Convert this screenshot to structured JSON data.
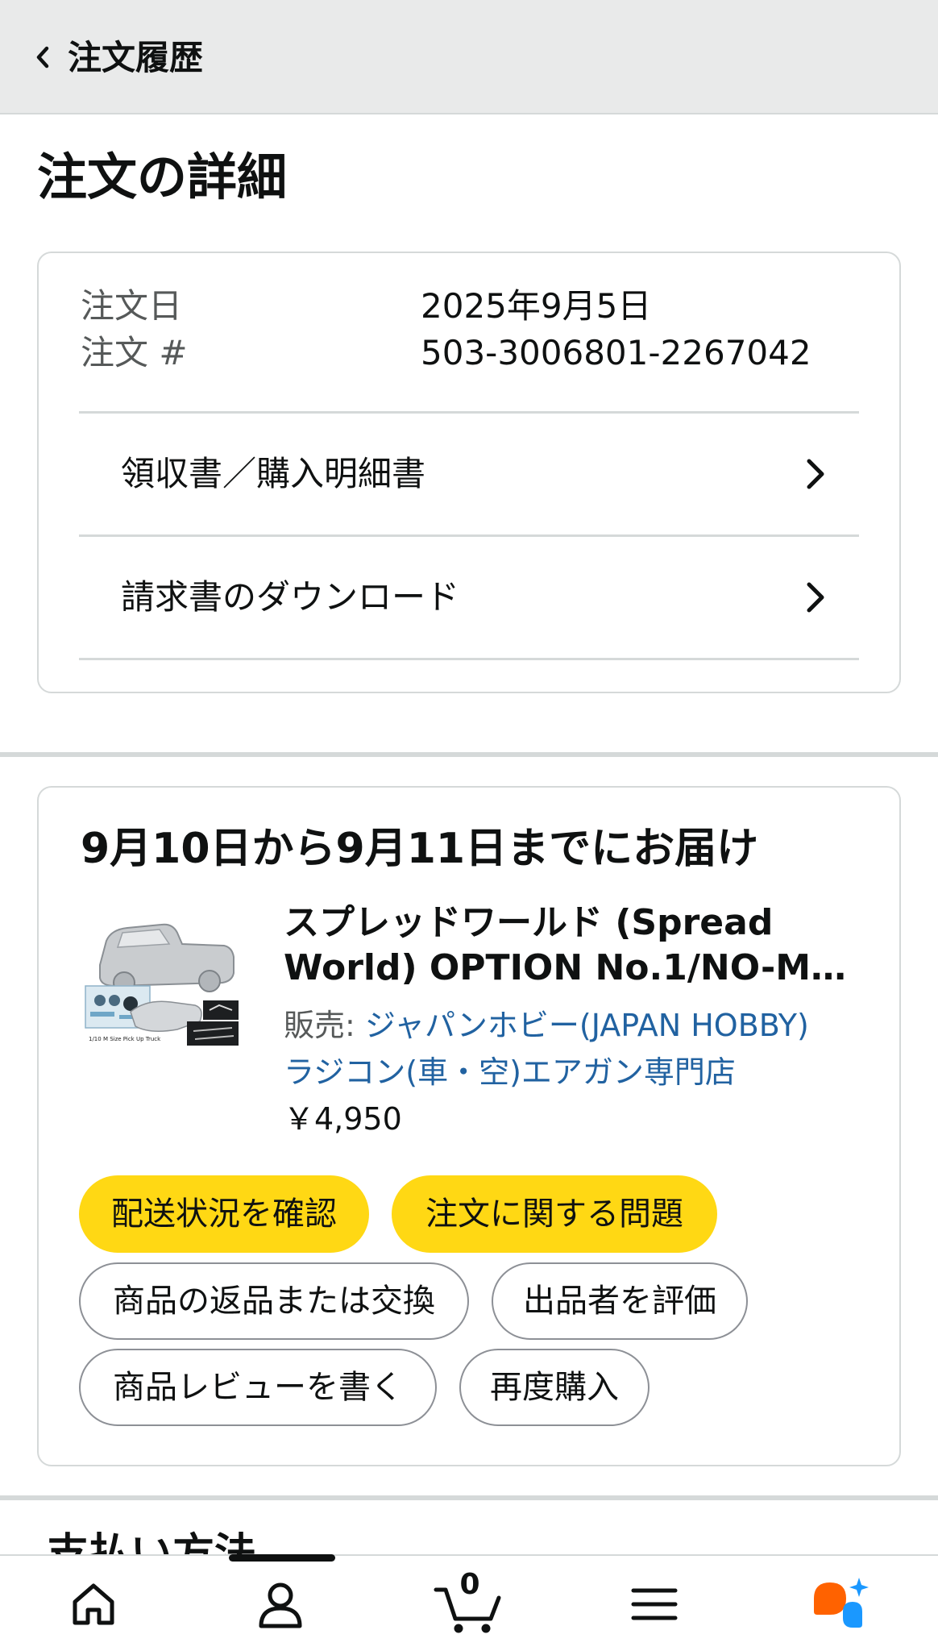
{
  "header": {
    "back_label": "注文履歴"
  },
  "page": {
    "title": "注文の詳細"
  },
  "order_info": {
    "date_label": "注文日",
    "date_value": "2025年9月5日",
    "number_label": "注文 #",
    "number_value": "503-3006801-2267042"
  },
  "links": {
    "receipt": "領収書／購入明細書",
    "invoice": "請求書のダウンロード"
  },
  "shipment": {
    "delivery_title": "9月10日から9月11日までにお届け",
    "product_title_line1": "スプレッドワールド (Spread",
    "product_title_line2": "World) OPTION No.1/NO-M…",
    "image_caption": "1/10 M Size Pick Up Truck",
    "seller_label": "販売: ",
    "seller_name_line1": "ジャパンホビー(JAPAN HOBBY)",
    "seller_name_line2": "ラジコン(車・空)エアガン専門店",
    "price": "￥4,950"
  },
  "actions": {
    "track": "配送状況を確認",
    "problem": "注文に関する問題",
    "return": "商品の返品または交換",
    "rate_seller": "出品者を評価",
    "write_review": "商品レビューを書く",
    "buy_again": "再度購入"
  },
  "next_section": {
    "title": "支払い方法"
  },
  "nav": {
    "cart_count": "0",
    "icons": [
      "home-icon",
      "account-icon",
      "cart-icon",
      "menu-icon",
      "assistant-icon"
    ]
  },
  "colors": {
    "primary_button": "#ffd814",
    "link": "#2162a1",
    "assistant_orange": "#ff6200",
    "assistant_blue": "#1a98ff"
  }
}
